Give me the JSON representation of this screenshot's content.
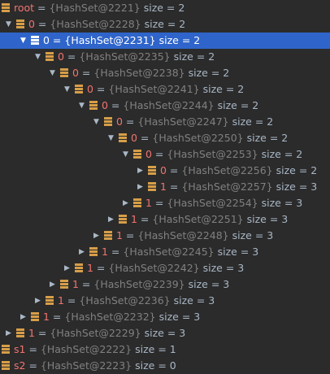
{
  "tree": {
    "nodes": [
      {
        "name": "root",
        "id": "{HashSet@2221}",
        "size": "size = 2",
        "expanded": true,
        "depth": 0
      },
      {
        "name": "0",
        "id": "{HashSet@2228}",
        "size": "size = 2",
        "expanded": true,
        "depth": 1
      },
      {
        "name": "0",
        "id": "{HashSet@2231}",
        "size": "size = 2",
        "expanded": true,
        "depth": 2,
        "selected": true
      },
      {
        "name": "0",
        "id": "{HashSet@2235}",
        "size": "size = 2",
        "expanded": true,
        "depth": 3
      },
      {
        "name": "0",
        "id": "{HashSet@2238}",
        "size": "size = 2",
        "expanded": true,
        "depth": 4
      },
      {
        "name": "0",
        "id": "{HashSet@2241}",
        "size": "size = 2",
        "expanded": true,
        "depth": 5
      },
      {
        "name": "0",
        "id": "{HashSet@2244}",
        "size": "size = 2",
        "expanded": true,
        "depth": 6
      },
      {
        "name": "0",
        "id": "{HashSet@2247}",
        "size": "size = 2",
        "expanded": true,
        "depth": 7
      },
      {
        "name": "0",
        "id": "{HashSet@2250}",
        "size": "size = 2",
        "expanded": true,
        "depth": 8
      },
      {
        "name": "0",
        "id": "{HashSet@2253}",
        "size": "size = 2",
        "expanded": true,
        "depth": 9
      },
      {
        "name": "0",
        "id": "{HashSet@2256}",
        "size": "size = 2",
        "expanded": false,
        "depth": 10
      },
      {
        "name": "1",
        "id": "{HashSet@2257}",
        "size": "size = 3",
        "expanded": false,
        "depth": 10
      },
      {
        "name": "1",
        "id": "{HashSet@2254}",
        "size": "size = 3",
        "expanded": false,
        "depth": 9
      },
      {
        "name": "1",
        "id": "{HashSet@2251}",
        "size": "size = 3",
        "expanded": false,
        "depth": 8
      },
      {
        "name": "1",
        "id": "{HashSet@2248}",
        "size": "size = 3",
        "expanded": false,
        "depth": 7
      },
      {
        "name": "1",
        "id": "{HashSet@2245}",
        "size": "size = 3",
        "expanded": false,
        "depth": 6
      },
      {
        "name": "1",
        "id": "{HashSet@2242}",
        "size": "size = 3",
        "expanded": false,
        "depth": 5
      },
      {
        "name": "1",
        "id": "{HashSet@2239}",
        "size": "size = 3",
        "expanded": false,
        "depth": 4
      },
      {
        "name": "1",
        "id": "{HashSet@2236}",
        "size": "size = 3",
        "expanded": false,
        "depth": 3
      },
      {
        "name": "1",
        "id": "{HashSet@2232}",
        "size": "size = 3",
        "expanded": false,
        "depth": 2
      },
      {
        "name": "1",
        "id": "{HashSet@2229}",
        "size": "size = 3",
        "expanded": false,
        "depth": 1
      },
      {
        "name": "s1",
        "id": "{HashSet@2222}",
        "size": "size = 1",
        "expanded": false,
        "depth": 0
      },
      {
        "name": "s2",
        "id": "{HashSet@2223}",
        "size": "size = 0",
        "expanded": false,
        "depth": 0
      }
    ]
  },
  "colors": {
    "background": "#2b2b2b",
    "selection": "#2f65ca",
    "field_name": "#f0746f",
    "object_id": "#808080",
    "text": "#a9b7c6",
    "field_icon": "#d79e48"
  },
  "icons": {
    "expanded": "triangle-down-icon",
    "collapsed": "triangle-right-icon",
    "field": "field-icon"
  }
}
